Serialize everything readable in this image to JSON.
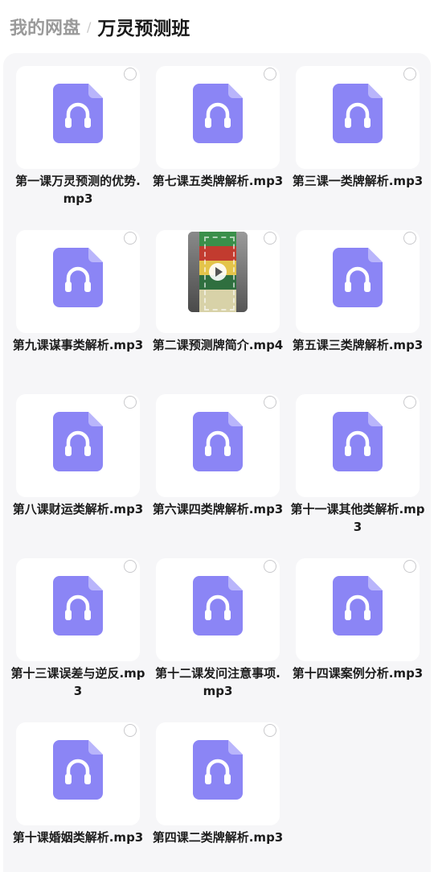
{
  "breadcrumb": {
    "root": "我的网盘",
    "separator": "/",
    "current": "万灵预测班"
  },
  "colors": {
    "audio_icon": "#8b85f5",
    "audio_icon_fold": "#b9b5fb",
    "panel_bg": "#f6f6f8"
  },
  "files": [
    {
      "name": "第一课万灵预测的优势.mp3",
      "type": "audio",
      "icon": "headphones-icon"
    },
    {
      "name": "第七课五类牌解析.mp3",
      "type": "audio",
      "icon": "headphones-icon"
    },
    {
      "name": "第三课一类牌解析.mp3",
      "type": "audio",
      "icon": "headphones-icon"
    },
    {
      "name": "第九课谋事类解析.mp3",
      "type": "audio",
      "icon": "headphones-icon"
    },
    {
      "name": "第二课预测牌简介.mp4",
      "type": "video",
      "icon": "video-thumbnail"
    },
    {
      "name": "第五课三类牌解析.mp3",
      "type": "audio",
      "icon": "headphones-icon"
    },
    {
      "name": "第八课财运类解析.mp3",
      "type": "audio",
      "icon": "headphones-icon"
    },
    {
      "name": "第六课四类牌解析.mp3",
      "type": "audio",
      "icon": "headphones-icon"
    },
    {
      "name": "第十一课其他类解析.mp3",
      "type": "audio",
      "icon": "headphones-icon"
    },
    {
      "name": "第十三课误差与逆反.mp3",
      "type": "audio",
      "icon": "headphones-icon"
    },
    {
      "name": "第十二课发问注意事项.mp3",
      "type": "audio",
      "icon": "headphones-icon"
    },
    {
      "name": "第十四课案例分析.mp3",
      "type": "audio",
      "icon": "headphones-icon"
    },
    {
      "name": "第十课婚姻类解析.mp3",
      "type": "audio",
      "icon": "headphones-icon"
    },
    {
      "name": "第四课二类牌解析.mp3",
      "type": "audio",
      "icon": "headphones-icon"
    }
  ]
}
